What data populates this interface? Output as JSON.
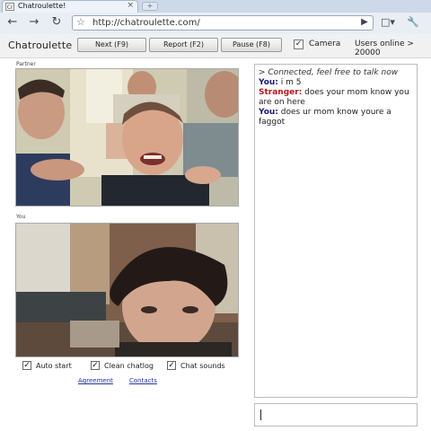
{
  "browser": {
    "tab_favicon": "Cr",
    "tab_title": "Chatroulette!",
    "tab_close": "×",
    "new_tab": "+",
    "url": "http://chatroulette.com/",
    "icons": [
      "back-icon",
      "forward-icon",
      "reload-icon",
      "star-icon",
      "go-icon",
      "page-icon",
      "wrench-icon"
    ]
  },
  "header": {
    "brand": "Chatroulette",
    "next_label": "Next (F9)",
    "report_label": "Report (F2)",
    "pause_label": "Pause (F8)",
    "camera_label": "Camera",
    "camera_checked": true,
    "online_text": "Users online > 20000"
  },
  "videos": {
    "partner_label": "Partner",
    "you_label": "You"
  },
  "options": {
    "auto_start": "Auto start",
    "clean_chatlog": "Clean chatlog",
    "chat_sounds": "Chat sounds",
    "checked": true
  },
  "links": {
    "agreement": "Agreement",
    "contacts": "Contacts"
  },
  "chat": {
    "system_message": "> Connected, feel free to talk now",
    "messages": [
      {
        "speaker": "You:",
        "text": " i m 5"
      },
      {
        "speaker": "Stranger:",
        "text": " does your mom know you are on here"
      },
      {
        "speaker": "You:",
        "text": " does ur mom know youre a faggot"
      }
    ],
    "input_value": ""
  }
}
